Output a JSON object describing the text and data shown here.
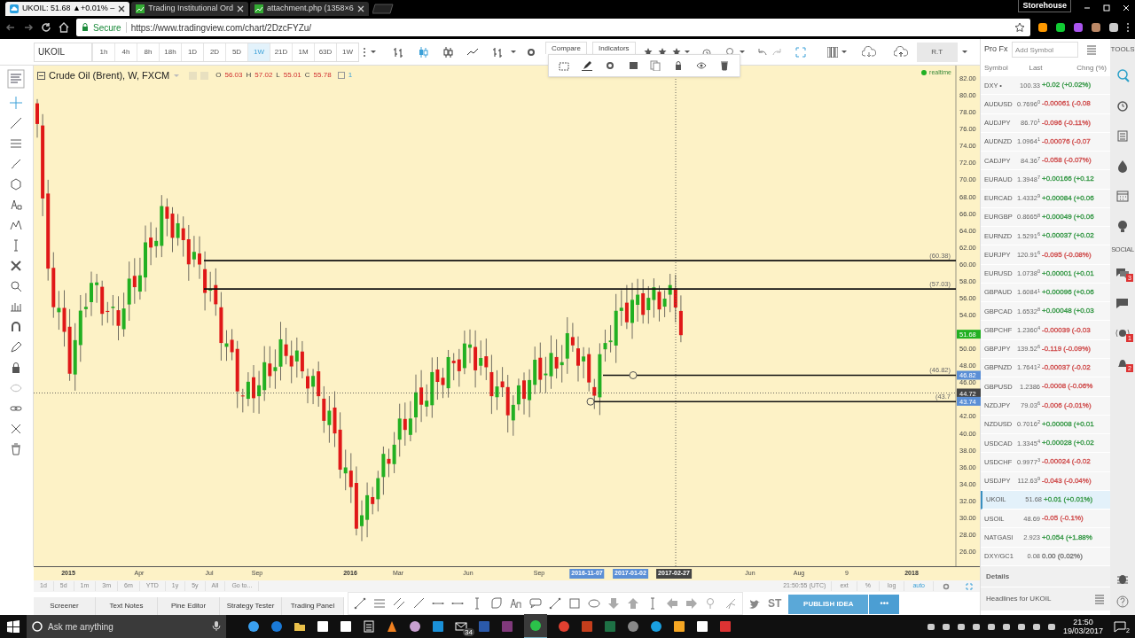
{
  "browser": {
    "tabs": [
      {
        "title": "UKOIL: 51.68 ▲+0.01% –",
        "selected": true
      },
      {
        "title": "Trading Institutional Ord",
        "selected": false
      },
      {
        "title": "attachment.php (1358×6",
        "selected": false
      }
    ],
    "profile": "Storehouse",
    "secure_label": "Secure",
    "url": "https://www.tradingview.com/chart/2DzcFYZu/"
  },
  "toolbar": {
    "symbol": "UKOIL",
    "intervals": [
      {
        "label": "1h",
        "selected": false
      },
      {
        "label": "4h",
        "selected": false
      },
      {
        "label": "8h",
        "selected": false
      },
      {
        "label": "18h",
        "selected": false
      },
      {
        "label": "1D",
        "selected": false
      },
      {
        "label": "2D",
        "selected": false
      },
      {
        "label": "5D",
        "selected": false
      },
      {
        "label": "1W",
        "selected": true
      },
      {
        "label": "21D",
        "selected": false
      },
      {
        "label": "1M",
        "selected": false
      },
      {
        "label": "63D",
        "selected": false
      },
      {
        "label": "1W",
        "selected": false
      }
    ],
    "buttons": [
      "Compare",
      "Indicators"
    ],
    "account": "R.T"
  },
  "legend": {
    "title": "Crude Oil (Brent), W, FXCM",
    "ohlc": [
      {
        "key": "O",
        "value": "56.03"
      },
      {
        "key": "H",
        "value": "57.02"
      },
      {
        "key": "L",
        "value": "55.01"
      },
      {
        "key": "C",
        "value": "55.78"
      }
    ],
    "count": "1",
    "status": "realtime"
  },
  "chart": {
    "price_labels": [
      "82.00",
      "80.00",
      "78.00",
      "76.00",
      "74.00",
      "72.00",
      "70.00",
      "68.00",
      "66.00",
      "64.00",
      "62.00",
      "60.00",
      "58.00",
      "56.00",
      "54.00",
      "50.00",
      "48.00",
      "46.00",
      "42.00",
      "40.00",
      "38.00",
      "36.00",
      "34.00",
      "32.00",
      "30.00",
      "28.00",
      "26.00"
    ],
    "levels": [
      {
        "label": "(60.38)",
        "handle": false
      },
      {
        "label": "(57.03)",
        "handle": false
      },
      {
        "label": "(46.82)",
        "handle": true
      },
      {
        "label": "(43.7",
        "handle": true
      }
    ],
    "price_tags": [
      {
        "text": "51.68",
        "kind": "last"
      },
      {
        "text": "46.82",
        "kind": "level"
      },
      {
        "text": "44.72",
        "kind": "cursor"
      },
      {
        "text": "43.74",
        "kind": "level"
      }
    ],
    "time_labels": [
      {
        "text": "2015",
        "kind": "year"
      },
      {
        "text": "Apr",
        "kind": "month"
      },
      {
        "text": "Jul",
        "kind": "month"
      },
      {
        "text": "Sep",
        "kind": "month"
      },
      {
        "text": "2016",
        "kind": "year"
      },
      {
        "text": "Mar",
        "kind": "month"
      },
      {
        "text": "Jun",
        "kind": "month"
      },
      {
        "text": "Sep",
        "kind": "month"
      },
      {
        "text": "2016-11-07",
        "kind": "date"
      },
      {
        "text": "2017-01-02",
        "kind": "date"
      },
      {
        "text": "2017-02-27",
        "kind": "cursor"
      },
      {
        "text": "Jun",
        "kind": "month"
      },
      {
        "text": "Aug",
        "kind": "month"
      },
      {
        "text": "9",
        "kind": "month"
      },
      {
        "text": "2018",
        "kind": "year"
      }
    ]
  },
  "range_bar": {
    "ranges": [
      "1d",
      "5d",
      "1m",
      "3m",
      "6m",
      "YTD",
      "1y",
      "5y",
      "All",
      "Go to..."
    ],
    "clock": "21:50:55 (UTC)",
    "options": [
      {
        "label": "ext",
        "active": false
      },
      {
        "label": "%",
        "active": false
      },
      {
        "label": "log",
        "active": false
      },
      {
        "label": "auto",
        "active": true
      }
    ]
  },
  "bottom_tabs": [
    "Screener",
    "Text Notes",
    "Pine Editor",
    "Strategy Tester",
    "Trading Panel"
  ],
  "share": {
    "stocktwits": "ST",
    "publish": "PUBLISH IDEA",
    "more": "•••"
  },
  "watchlist": {
    "title": "Pro Fx",
    "placeholder": "Add Symbol",
    "columns": [
      "Symbol",
      "Last",
      "Chng (%)"
    ],
    "rows": [
      {
        "symbol": "DXY •",
        "last": "100.33",
        "change": "+0.02 (+0.02%)",
        "color": "#3a9a4a",
        "selected": false
      },
      {
        "symbol": "AUDUSD",
        "last": "0.7696$^{0}$",
        "change": "-0.00061 (-0.08",
        "color": "#d05050",
        "selected": false
      },
      {
        "symbol": "AUDJPY",
        "last": "86.70$^{1}$",
        "change": "-0.096 (-0.11%)",
        "color": "#d05050",
        "selected": false
      },
      {
        "symbol": "AUDNZD",
        "last": "1.0964$^{1}$",
        "change": "-0.00076 (-0.07",
        "color": "#d05050",
        "selected": false
      },
      {
        "symbol": "CADJPY",
        "last": "84.36$^{7}$",
        "change": "-0.058 (-0.07%)",
        "color": "#d05050",
        "selected": false
      },
      {
        "symbol": "EURAUD",
        "last": "1.3948$^{7}$",
        "change": "+0.00166 (+0.12",
        "color": "#3a9a4a",
        "selected": false
      },
      {
        "symbol": "EURCAD",
        "last": "1.4332$^{9}$",
        "change": "+0.00084 (+0.06",
        "color": "#3a9a4a",
        "selected": false
      },
      {
        "symbol": "EURGBP",
        "last": "0.8665$^{8}$",
        "change": "+0.00049 (+0.06",
        "color": "#3a9a4a",
        "selected": false
      },
      {
        "symbol": "EURNZD",
        "last": "1.5291$^{6}$",
        "change": "+0.00037 (+0.02",
        "color": "#3a9a4a",
        "selected": false
      },
      {
        "symbol": "EURJPY",
        "last": "120.91$^{6}$",
        "change": "-0.095 (-0.08%)",
        "color": "#d05050",
        "selected": false
      },
      {
        "symbol": "EURUSD",
        "last": "1.0738$^{0}$",
        "change": "+0.00001 (+0.01",
        "color": "#3a9a4a",
        "selected": false
      },
      {
        "symbol": "GBPAUD",
        "last": "1.6084$^{1}$",
        "change": "+0.00096 (+0.06",
        "color": "#3a9a4a",
        "selected": false
      },
      {
        "symbol": "GBPCAD",
        "last": "1.6532$^{8}$",
        "change": "+0.00048 (+0.03",
        "color": "#3a9a4a",
        "selected": false
      },
      {
        "symbol": "GBPCHF",
        "last": "1.2360$^{4}$",
        "change": "-0.00039 (-0.03",
        "color": "#d05050",
        "selected": false
      },
      {
        "symbol": "GBPJPY",
        "last": "139.52$^{6}$",
        "change": "-0.119 (-0.09%)",
        "color": "#d05050",
        "selected": false
      },
      {
        "symbol": "GBPNZD",
        "last": "1.7641$^{2}$",
        "change": "-0.00037 (-0.02",
        "color": "#d05050",
        "selected": false
      },
      {
        "symbol": "GBPUSD",
        "last": "1.2386",
        "change": "-0.0008 (-0.06%",
        "color": "#d05050",
        "selected": false
      },
      {
        "symbol": "NZDJPY",
        "last": "79.03$^{6}$",
        "change": "-0.006 (-0.01%)",
        "color": "#d05050",
        "selected": false
      },
      {
        "symbol": "NZDUSD",
        "last": "0.7016$^{2}$",
        "change": "+0.00008 (+0.01",
        "color": "#3a9a4a",
        "selected": false
      },
      {
        "symbol": "USDCAD",
        "last": "1.3345$^{4}$",
        "change": "+0.00028 (+0.02",
        "color": "#3a9a4a",
        "selected": false
      },
      {
        "symbol": "USDCHF",
        "last": "0.9977$^{3}$",
        "change": "-0.00024 (-0.02",
        "color": "#d05050",
        "selected": false
      },
      {
        "symbol": "USDJPY",
        "last": "112.63$^{9}$",
        "change": "-0.043 (-0.04%)",
        "color": "#d05050",
        "selected": false
      },
      {
        "symbol": "UKOIL",
        "last": "51.68",
        "change": "+0.01 (+0.01%)",
        "color": "#3a9a4a",
        "selected": true
      },
      {
        "symbol": "USOIL",
        "last": "48.69",
        "change": "-0.05 (-0.1%)",
        "color": "#d05050",
        "selected": false
      },
      {
        "symbol": "NATGASI",
        "last": "2.923",
        "change": "+0.054 (+1.88%",
        "color": "#3a9a4a",
        "selected": false
      },
      {
        "symbol": "DXY/GC1",
        "last": "0.08",
        "change": "0.00 (0.02%)",
        "color": "#777777",
        "selected": false
      }
    ],
    "details": "Details",
    "headlines": "Headlines for UKOIL"
  },
  "tools": {
    "title": "TOOLS",
    "section": "SOCIAL",
    "badges": [
      "3",
      "1",
      "2"
    ]
  },
  "taskbar": {
    "search_placeholder": "Ask me anything",
    "mail_badge": "34",
    "time": "21:50",
    "date": "19/03/2017",
    "notifications": "2"
  }
}
